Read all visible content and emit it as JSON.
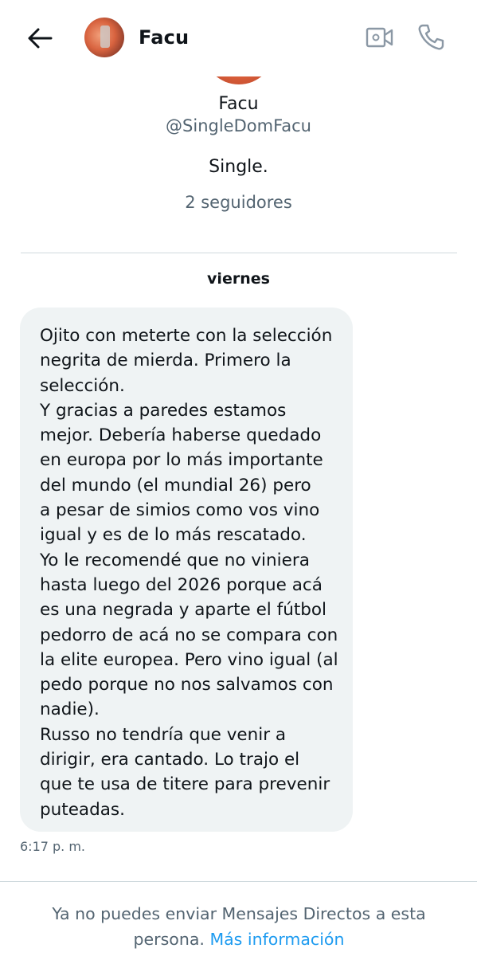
{
  "header": {
    "name": "Facu"
  },
  "profile": {
    "name": "Facu",
    "handle": "@SingleDomFacu",
    "bio": "Single.",
    "followers": "2 seguidores"
  },
  "conversation": {
    "day_label": "viernes",
    "message": {
      "lines": [
        "Ojito con meterte con la selección",
        "negrita de mierda. Primero la",
        "selección.",
        "Y gracias a paredes estamos",
        "mejor. Debería haberse quedado",
        "en europa por lo más importante",
        "del mundo (el mundial 26) pero",
        "a pesar de simios como vos vino",
        "igual y es de lo más rescatado.",
        "Yo le recomendé que no viniera",
        "hasta luego del 2026 porque acá",
        "es una negrada y aparte el fútbol",
        "pedorro de acá no se compara con",
        "la elite europea. Pero vino igual (al",
        "pedo porque no nos salvamos con",
        "nadie).",
        "Russo no tendría que venir a",
        "dirigir, era cantado. Lo trajo el",
        "que te usa de titere para prevenir",
        "puteadas."
      ],
      "time": "6:17 p. m."
    }
  },
  "footer": {
    "notice_text": "Ya no puedes enviar Mensajes Directos a esta persona.",
    "link_text": "Más información"
  },
  "icons": {
    "back": "arrow-left-icon",
    "video": "video-camera-icon",
    "phone": "phone-icon"
  },
  "colors": {
    "link": "#1d9bf0",
    "secondary_text": "#536471",
    "bubble_bg": "#eff3f4",
    "divider": "#cfd9de"
  }
}
